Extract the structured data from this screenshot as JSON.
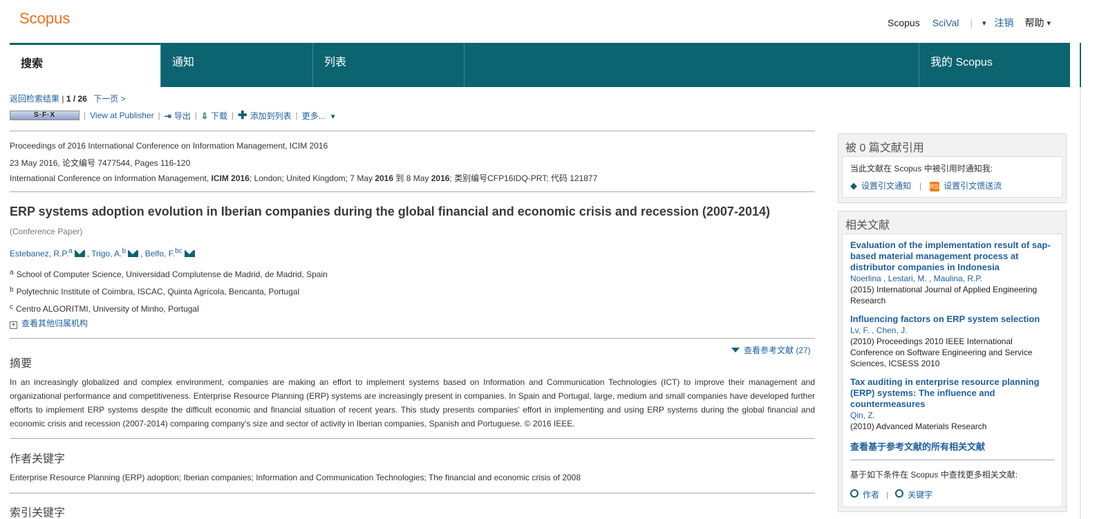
{
  "header": {
    "logo": "Scopus",
    "nav": {
      "scopus": "Scopus",
      "scival": "SciVal",
      "sep": "|",
      "arrow": "▾",
      "logout": "注销",
      "help": "帮助",
      "help_arrow": "▾"
    }
  },
  "tabs": {
    "search": "搜索",
    "notice": "通知",
    "list": "列表",
    "my_scopus": "我的 Scopus"
  },
  "breadcrumb": {
    "back": "返回检索结果",
    "sep": " | ",
    "position": "1 / 26",
    "next": "下一页 >"
  },
  "toolbar": {
    "sfx": "S·F·X",
    "publisher": "View at Publisher",
    "export": "导出",
    "download": "下载",
    "add_to_list": "添加到列表",
    "more": "更多...",
    "sep": "|"
  },
  "doc": {
    "conference_line1": "Proceedings of 2016 International Conference on Information Management, ICIM 2016",
    "conference_line2": "23 May 2016, 论文编号 7477544, Pages 116-120",
    "conf3_a": "International Conference on Information Management, ",
    "conf3_icim": "ICIM 2016",
    "conf3_b": "; London; United Kingdom; 7 May ",
    "conf3_y1": "2016",
    "conf3_c": " 到 8 May ",
    "conf3_y2": "2016",
    "conf3_d": "; 类别编号CFP16IDQ-PRT; 代码 121877",
    "title": "ERP systems adoption evolution in Iberian companies during the global financial and economic crisis and recession (2007-2014)",
    "paper_type": "(Conference Paper)",
    "authors": [
      {
        "name": "Estebanez, R.P.",
        "sup": "a"
      },
      {
        "name": "Trigo, A.",
        "sup": "b"
      },
      {
        "name": "Belfo, F.",
        "sup": "bc"
      }
    ],
    "author_sep": ",",
    "affiliations": [
      {
        "sup": "a",
        "text": "School of Computer Science, Universidad Complutense de Madrid, de Madrid, Spain"
      },
      {
        "sup": "b",
        "text": "Polytechnic Institute of Coimbra, ISCAC, Quinta Agrícola, Bencanta, Portugal"
      },
      {
        "sup": "c",
        "text": "Centro ALGORITMI, University of Minho, Portugal"
      }
    ],
    "more_affil_box": "+",
    "more_affil": "查看其他归属机构",
    "refs_link": "查看参考文献 (27)",
    "abstract_h": "摘要",
    "abstract": "In an increasingly globalized and complex environment, companies are making an effort to implement systems based on Information and Communication Technologies (ICT) to improve their management and organizational performance and competitiveness. Enterprise Resource Planning (ERP) systems are increasingly present in companies. In Spain and Portugal, large, medium and small companies have developed further efforts to implement ERP systems despite the difficult economic and financial situation of recent years. This study presents companies' effort in implementing and using ERP systems during the global financial and economic crisis and recession (2007-2014) comparing company's size and sector of activity in Iberian companies, Spanish and Portuguese. © 2016 IEEE.",
    "author_kw_h": "作者关键字",
    "author_kw": "Enterprise Resource Planning (ERP) adoption; Iberian companies; Information and Communication Technologies; The financial and economic crisis of 2008",
    "index_kw_h": "索引关键字"
  },
  "cited": {
    "title": "被 0 篇文献引用",
    "notice": "当此文献在 Scopus 中被引用时通知我:",
    "set_alert": "设置引文通知",
    "sep": "|",
    "set_feed": "设置引文馈送流",
    "rss": "RSS"
  },
  "related": {
    "title": "相关文献",
    "items": [
      {
        "title": "Evaluation of the implementation result of sap-based material management process at distributor companies in Indonesia",
        "authors": "Noerlina , Lestari, M. , Maulina, R.P.",
        "source": "(2015) International Journal of Applied Engineering Research"
      },
      {
        "title": "Influencing factors on ERP system selection",
        "authors": "Lv, F. , Chen, J.",
        "source": "(2010) Proceedings 2010 IEEE International Conference on Software Engineering and Service Sciences, ICSESS 2010"
      },
      {
        "title": "Tax auditing in enterprise resource planning (ERP) systems: The influence and countermeasures",
        "authors": "Qin, Z.",
        "source": "(2010) Advanced Materials Research"
      }
    ],
    "all_link": "查看基于参考文献的所有相关文献",
    "find_more": "基于如下条件在 Scopus 中查找更多相关文献:",
    "by_author": "作者",
    "sep": "|",
    "by_keyword": "关键字"
  },
  "colors": {
    "teal": "#0c6470",
    "orange": "#e9711c",
    "link": "#1f5fa0"
  }
}
